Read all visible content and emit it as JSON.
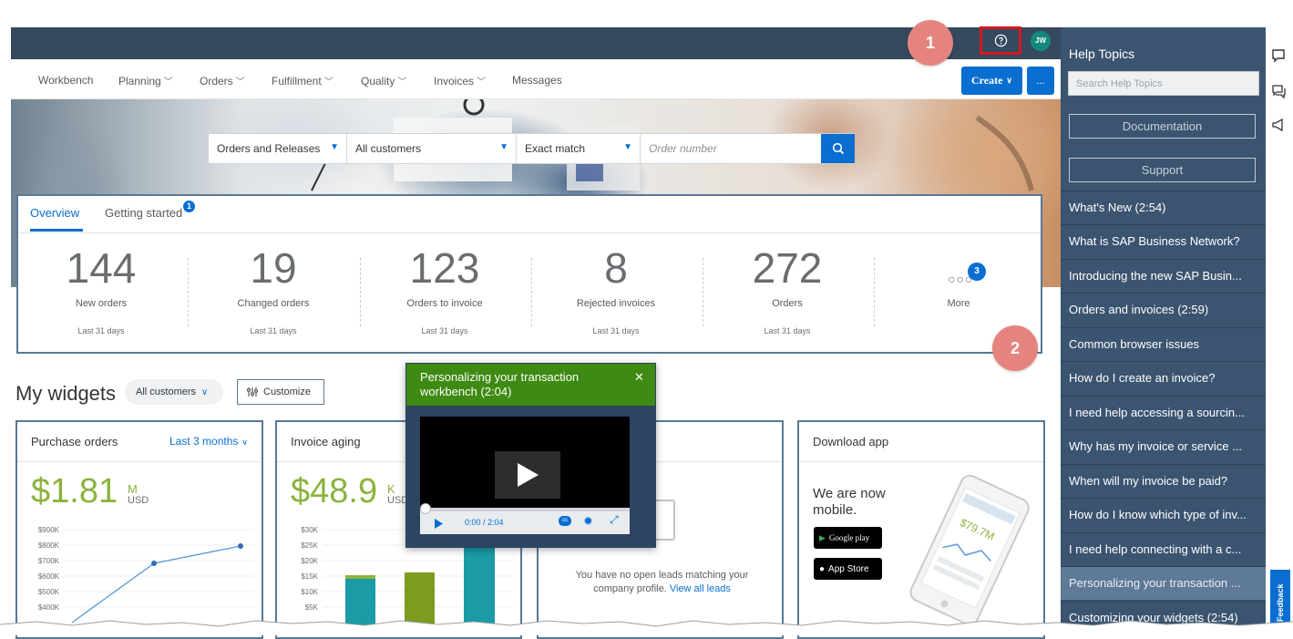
{
  "nav": {
    "items": [
      {
        "label": "Workbench",
        "dropdown": false
      },
      {
        "label": "Planning",
        "dropdown": true
      },
      {
        "label": "Orders",
        "dropdown": true
      },
      {
        "label": "Fulfillment",
        "dropdown": true
      },
      {
        "label": "Quality",
        "dropdown": true
      },
      {
        "label": "Invoices",
        "dropdown": true
      },
      {
        "label": "Messages",
        "dropdown": false
      }
    ],
    "create_label": "Create",
    "more_label": "...",
    "avatar_initials": "JW"
  },
  "search": {
    "doc_type": "Orders and Releases",
    "customer": "All customers",
    "match": "Exact match",
    "placeholder": "Order number"
  },
  "overview": {
    "tab_overview": "Overview",
    "tab_getting_started": "Getting started",
    "getting_started_badge": "1",
    "stats": [
      {
        "value": "144",
        "label": "New orders",
        "period": "Last 31 days"
      },
      {
        "value": "19",
        "label": "Changed orders",
        "period": "Last 31 days"
      },
      {
        "value": "123",
        "label": "Orders to invoice",
        "period": "Last 31 days"
      },
      {
        "value": "8",
        "label": "Rejected invoices",
        "period": "Last 31 days"
      },
      {
        "value": "272",
        "label": "Orders",
        "period": "Last 31 days"
      }
    ],
    "more_label": "More",
    "more_badge": "3"
  },
  "steps": {
    "one": "1",
    "two": "2"
  },
  "widgets": {
    "title": "My widgets",
    "customer_filter": "All customers",
    "customize_label": "Customize",
    "purchase_orders": {
      "title": "Purchase orders",
      "period": "Last 3 months",
      "amount": "$1.81",
      "unit_top": "M",
      "unit_bottom": "USD",
      "y_ticks": [
        "$900K",
        "$800K",
        "$700K",
        "$600K",
        "$500K",
        "$400K"
      ]
    },
    "invoice_aging": {
      "title": "Invoice aging",
      "amount": "$48.9",
      "unit_top": "K",
      "unit_bottom": "USD",
      "y_ticks": [
        "$30K",
        "$25K",
        "$20K",
        "$15K",
        "$10K",
        "$5K"
      ]
    },
    "leads": {
      "empty_text": "You have no open leads matching your company profile.",
      "link": "View all leads"
    },
    "download_app": {
      "title": "Download app",
      "text_line1": "We are now",
      "text_line2": "mobile.",
      "google_play": "Google play",
      "app_store": "App Store"
    }
  },
  "video": {
    "title": "Personalizing your transaction workbench (2:04)",
    "time": "0:00  / 2:04"
  },
  "help": {
    "title": "Help Topics",
    "search_placeholder": "Search Help Topics",
    "documentation": "Documentation",
    "support": "Support",
    "topics": [
      "What's New (2:54)",
      "What is SAP Business Network?",
      "Introducing the new SAP Busin...",
      "Orders and invoices (2:59)",
      "Common browser issues",
      "How do I create an invoice?",
      "I need help accessing a sourcin...",
      "Why has my invoice or service ...",
      "When will my invoice be paid?",
      "How do I know which type of inv...",
      "I need help connecting with a c...",
      "Personalizing your transaction ...",
      "Customizing your widgets (2:54)"
    ],
    "feedback": "Feedback"
  },
  "colors": {
    "shell": "#354a5f",
    "brand_blue": "#0a6ed1",
    "panel": "#3b5470",
    "accent_green": "#8bb33d",
    "video_header": "#3e8a12",
    "step_circle": "#e5847e",
    "highlight_red": "#d3191d"
  }
}
